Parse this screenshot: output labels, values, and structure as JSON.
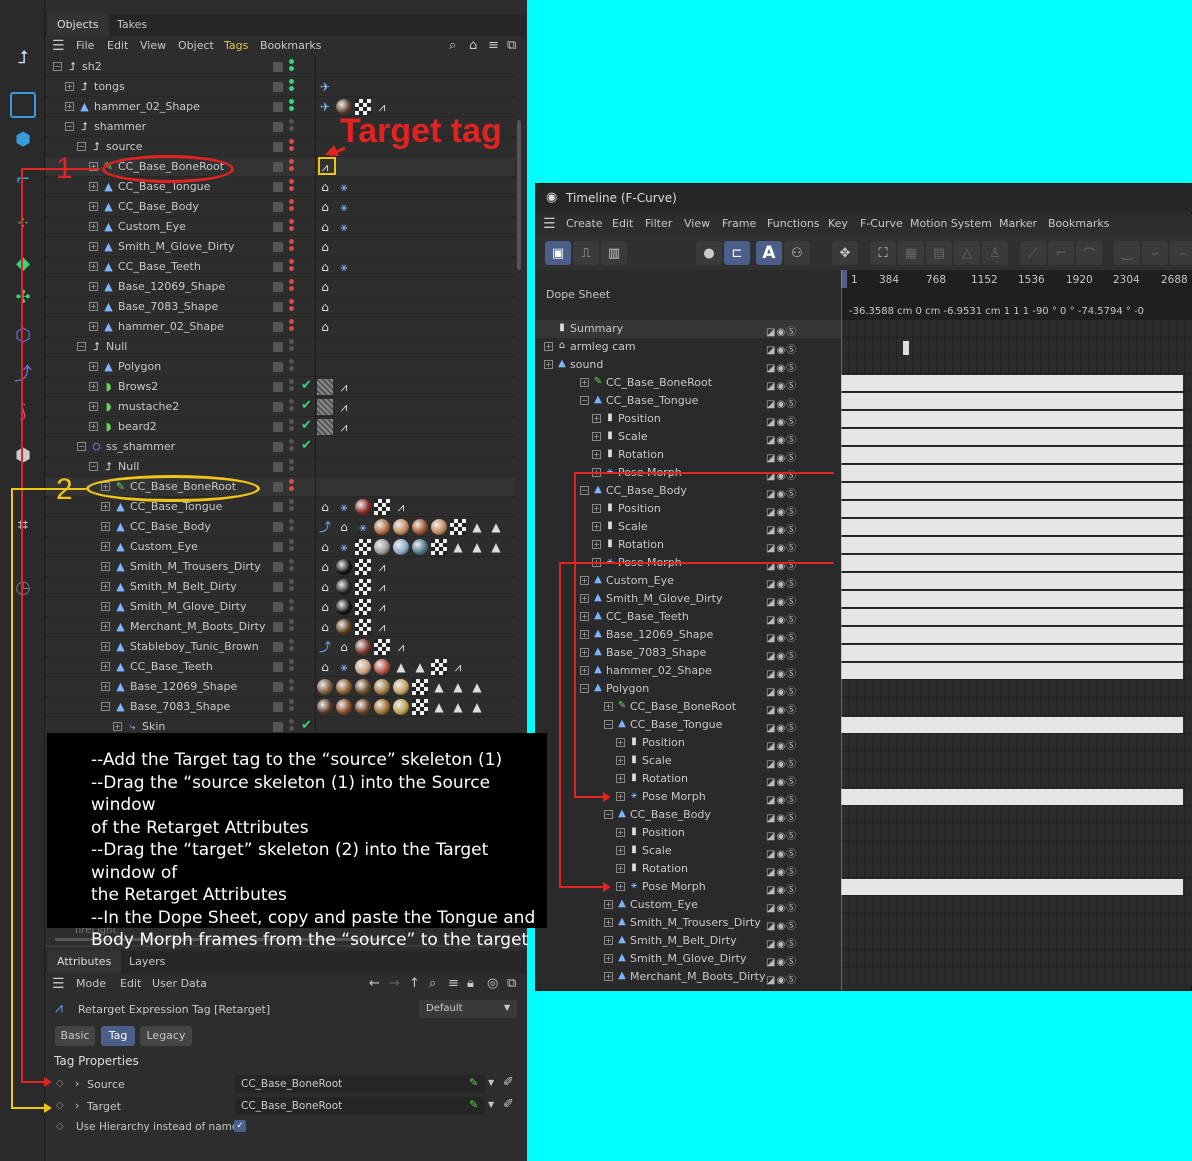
{
  "left_toolbar": {
    "icons": [
      "coordinate-icon",
      "rectangle-select-icon",
      "cube-icon",
      "tag-icon",
      "point-icon",
      "green-cube-icon",
      "cluster-icon",
      "polygon-icon",
      "joint-icon",
      "pose-icon",
      "hex-icon",
      "arrow-icon",
      "timer-icon"
    ]
  },
  "objects_panel": {
    "tabs": [
      "Objects",
      "Takes"
    ],
    "menu": [
      "File",
      "Edit",
      "View",
      "Object",
      "Tags",
      "Bookmarks"
    ],
    "rows": [
      {
        "name": "sh2"
      },
      {
        "name": "tongs"
      },
      {
        "name": "hammer_02_Shape"
      },
      {
        "name": "shammer"
      },
      {
        "name": "source"
      },
      {
        "name": "CC_Base_BoneRoot"
      },
      {
        "name": "CC_Base_Tongue"
      },
      {
        "name": "CC_Base_Body"
      },
      {
        "name": "Custom_Eye"
      },
      {
        "name": "Smith_M_Glove_Dirty"
      },
      {
        "name": "CC_Base_Teeth"
      },
      {
        "name": "Base_12069_Shape"
      },
      {
        "name": "Base_7083_Shape"
      },
      {
        "name": "hammer_02_Shape"
      },
      {
        "name": "Null"
      },
      {
        "name": "Polygon"
      },
      {
        "name": "Brows2"
      },
      {
        "name": "mustache2"
      },
      {
        "name": "beard2"
      },
      {
        "name": "ss_shammer"
      },
      {
        "name": "Null"
      },
      {
        "name": "CC_Base_BoneRoot"
      },
      {
        "name": "CC_Base_Tongue"
      },
      {
        "name": "CC_Base_Body"
      },
      {
        "name": "Custom_Eye"
      },
      {
        "name": "Smith_M_Trousers_Dirty"
      },
      {
        "name": "Smith_M_Belt_Dirty"
      },
      {
        "name": "Smith_M_Glove_Dirty"
      },
      {
        "name": "Merchant_M_Boots_Dirty"
      },
      {
        "name": "Stableboy_Tunic_Brown"
      },
      {
        "name": "CC_Base_Teeth"
      },
      {
        "name": "Base_12069_Shape"
      },
      {
        "name": "Base_7083_Shape"
      },
      {
        "name": "Skin"
      }
    ],
    "hidden_row": "fireLight"
  },
  "annotations": {
    "target_tag": "Target tag",
    "num1": "1",
    "num2": "2",
    "instructions": [
      "--Add the Target tag to the “source” skeleton (1)",
      "--Drag the “source skeleton (1) into the Source window",
      "of the Retarget Attributes",
      "--Drag the “target” skeleton (2) into the Target window of",
      "the Retarget Attributes",
      "--In the Dope Sheet, copy and paste the Tongue and",
      "Body Morph frames from the “source”  to the target"
    ]
  },
  "attributes_panel": {
    "tabs": [
      "Attributes",
      "Layers"
    ],
    "menu": [
      "Mode",
      "Edit",
      "User Data"
    ],
    "tag_title": "Retarget Expression Tag [Retarget]",
    "preset": "Default",
    "subtabs": [
      "Basic",
      "Tag",
      "Legacy"
    ],
    "section": "Tag Properties",
    "source_label": "Source",
    "source_value": "CC_Base_BoneRoot",
    "target_label": "Target",
    "target_value": "CC_Base_BoneRoot",
    "hierarchy_label": "Use Hierarchy instead of names"
  },
  "timeline": {
    "title": "Timeline (F-Curve)",
    "menu": [
      "Create",
      "Edit",
      "Filter",
      "View",
      "Frame",
      "Functions",
      "Key",
      "F-Curve",
      "Motion System",
      "Marker",
      "Bookmarks"
    ],
    "dope_sheet": "Dope Sheet",
    "ruler": [
      "1",
      "384",
      "768",
      "1152",
      "1536",
      "1920",
      "2304",
      "2688"
    ],
    "values": "-36.3588 cm   0 cm   -6.9531 cm   1   1   1   -90 °   0 °   -74.5794 °   -0",
    "rows": [
      {
        "name": "Summary"
      },
      {
        "name": "armleg cam"
      },
      {
        "name": "sound"
      },
      {
        "name": "CC_Base_BoneRoot"
      },
      {
        "name": "CC_Base_Tongue"
      },
      {
        "name": "Position"
      },
      {
        "name": "Scale"
      },
      {
        "name": "Rotation"
      },
      {
        "name": "Pose Morph"
      },
      {
        "name": "CC_Base_Body"
      },
      {
        "name": "Position"
      },
      {
        "name": "Scale"
      },
      {
        "name": "Rotation"
      },
      {
        "name": "Pose Morph"
      },
      {
        "name": "Custom_Eye"
      },
      {
        "name": "Smith_M_Glove_Dirty"
      },
      {
        "name": "CC_Base_Teeth"
      },
      {
        "name": "Base_12069_Shape"
      },
      {
        "name": "Base_7083_Shape"
      },
      {
        "name": "hammer_02_Shape"
      },
      {
        "name": "Polygon"
      },
      {
        "name": "CC_Base_BoneRoot"
      },
      {
        "name": "CC_Base_Tongue"
      },
      {
        "name": "Position"
      },
      {
        "name": "Scale"
      },
      {
        "name": "Rotation"
      },
      {
        "name": "Pose Morph"
      },
      {
        "name": "CC_Base_Body"
      },
      {
        "name": "Position"
      },
      {
        "name": "Scale"
      },
      {
        "name": "Rotation"
      },
      {
        "name": "Pose Morph"
      },
      {
        "name": "Custom_Eye"
      },
      {
        "name": "Smith_M_Trousers_Dirty"
      },
      {
        "name": "Smith_M_Belt_Dirty"
      },
      {
        "name": "Smith_M_Glove_Dirty"
      },
      {
        "name": "Merchant_M_Boots_Dirty"
      }
    ]
  },
  "colors": {
    "annotation_red": "#e32222",
    "annotation_yellow": "#f0c419",
    "accent_blue": "#4b5f8a",
    "background_cyan": "#00ffff"
  }
}
